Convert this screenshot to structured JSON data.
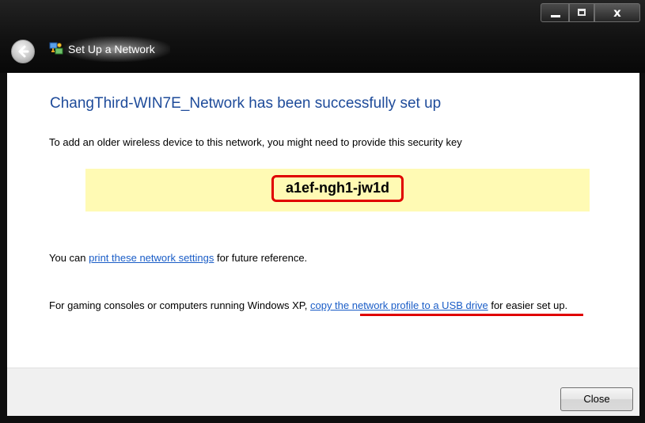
{
  "window": {
    "title": "Set Up a Network",
    "controls": {
      "minimize": "–",
      "maximize": "□",
      "close": "x"
    }
  },
  "content": {
    "heading": "ChangThird-WIN7E_Network has been successfully set up",
    "intro": "To add an older wireless device to this network, you might need to provide this security key",
    "security_key": "a1ef-ngh1-jw1d",
    "print_line": {
      "before": "You can ",
      "link": "print these network settings",
      "after": " for future reference."
    },
    "xp_line": {
      "before": "For gaming consoles or computers running Windows XP, ",
      "link": "copy the network profile to a USB drive",
      "after": " for easier set up."
    }
  },
  "footer": {
    "close_label": "Close"
  },
  "colors": {
    "heading": "#1e4b9a",
    "link": "#1a5dc7",
    "key_band": "#fffab4",
    "annotation_red": "#e00000"
  },
  "icons": {
    "back": "back-arrow-icon",
    "app": "network-setup-icon"
  }
}
